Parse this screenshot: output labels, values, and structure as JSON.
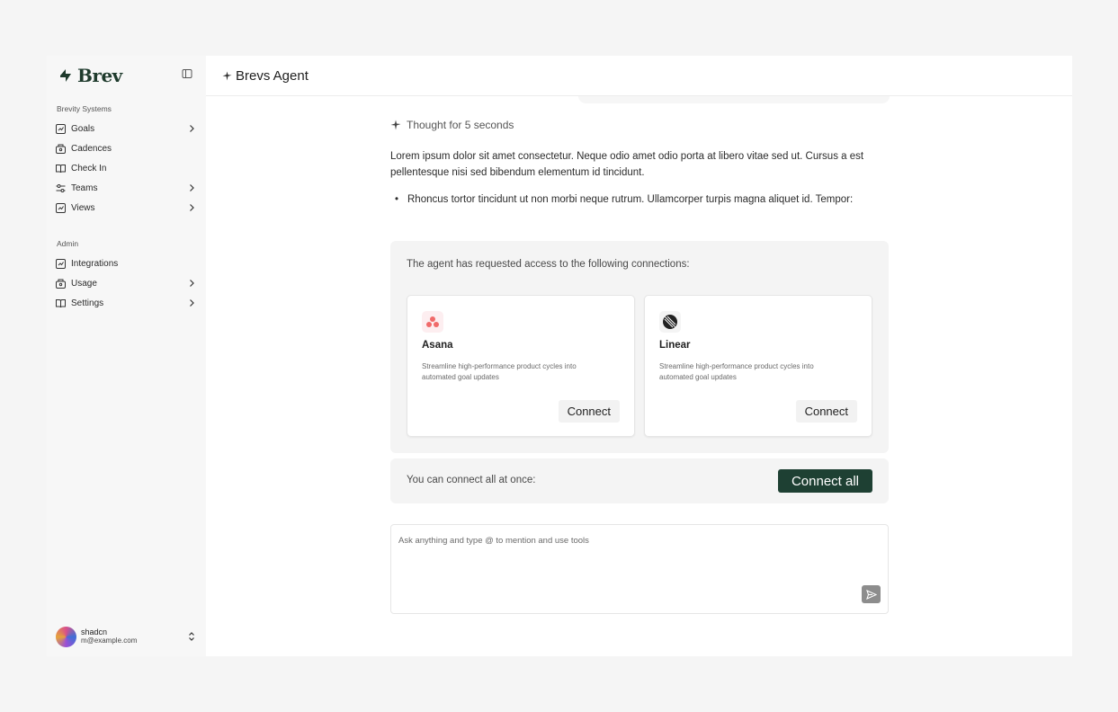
{
  "brand": {
    "name": "Brev"
  },
  "sidebar": {
    "workspace_label": "Brevity Systems",
    "workspace_items": [
      {
        "label": "Goals",
        "icon": "goals-icon",
        "has_chevron": true
      },
      {
        "label": "Cadences",
        "icon": "cadences-icon",
        "has_chevron": false
      },
      {
        "label": "Check In",
        "icon": "book-icon",
        "has_chevron": false
      },
      {
        "label": "Teams",
        "icon": "teams-icon",
        "has_chevron": true
      },
      {
        "label": "Views",
        "icon": "views-icon",
        "has_chevron": true
      }
    ],
    "admin_label": "Admin",
    "admin_items": [
      {
        "label": "Integrations",
        "icon": "integrations-icon",
        "has_chevron": false
      },
      {
        "label": "Usage",
        "icon": "usage-icon",
        "has_chevron": true
      },
      {
        "label": "Settings",
        "icon": "book-icon",
        "has_chevron": true
      }
    ],
    "user": {
      "name": "shadcn",
      "email": "m@example.com"
    }
  },
  "header": {
    "title": "Brevs Agent"
  },
  "conversation": {
    "thought": "Thought for 5 seconds",
    "paragraph": "Lorem ipsum dolor sit amet consectetur. Neque odio amet odio porta at libero vitae sed ut. Cursus a est pellentesque nisi sed bibendum elementum id tincidunt.",
    "bullet": "Rhoncus tortor tincidunt ut non morbi neque rutrum. Ullamcorper turpis magna aliquet id. Tempor:"
  },
  "access_request": {
    "prompt": "The agent has requested access to the following connections:",
    "connections": [
      {
        "name": "Asana",
        "description": "Streamline high-performance product cycles into automated goal updates",
        "button": "Connect",
        "icon": "asana-icon"
      },
      {
        "name": "Linear",
        "description": "Streamline high-performance product cycles into automated goal updates",
        "button": "Connect",
        "icon": "linear-icon"
      }
    ],
    "all_text": "You can connect all at once:",
    "all_button": "Connect all"
  },
  "composer": {
    "placeholder": "Ask anything and type @ to mention and use tools"
  },
  "colors": {
    "brand_green": "#1e4033",
    "asana_pink": "#f06a6a"
  }
}
